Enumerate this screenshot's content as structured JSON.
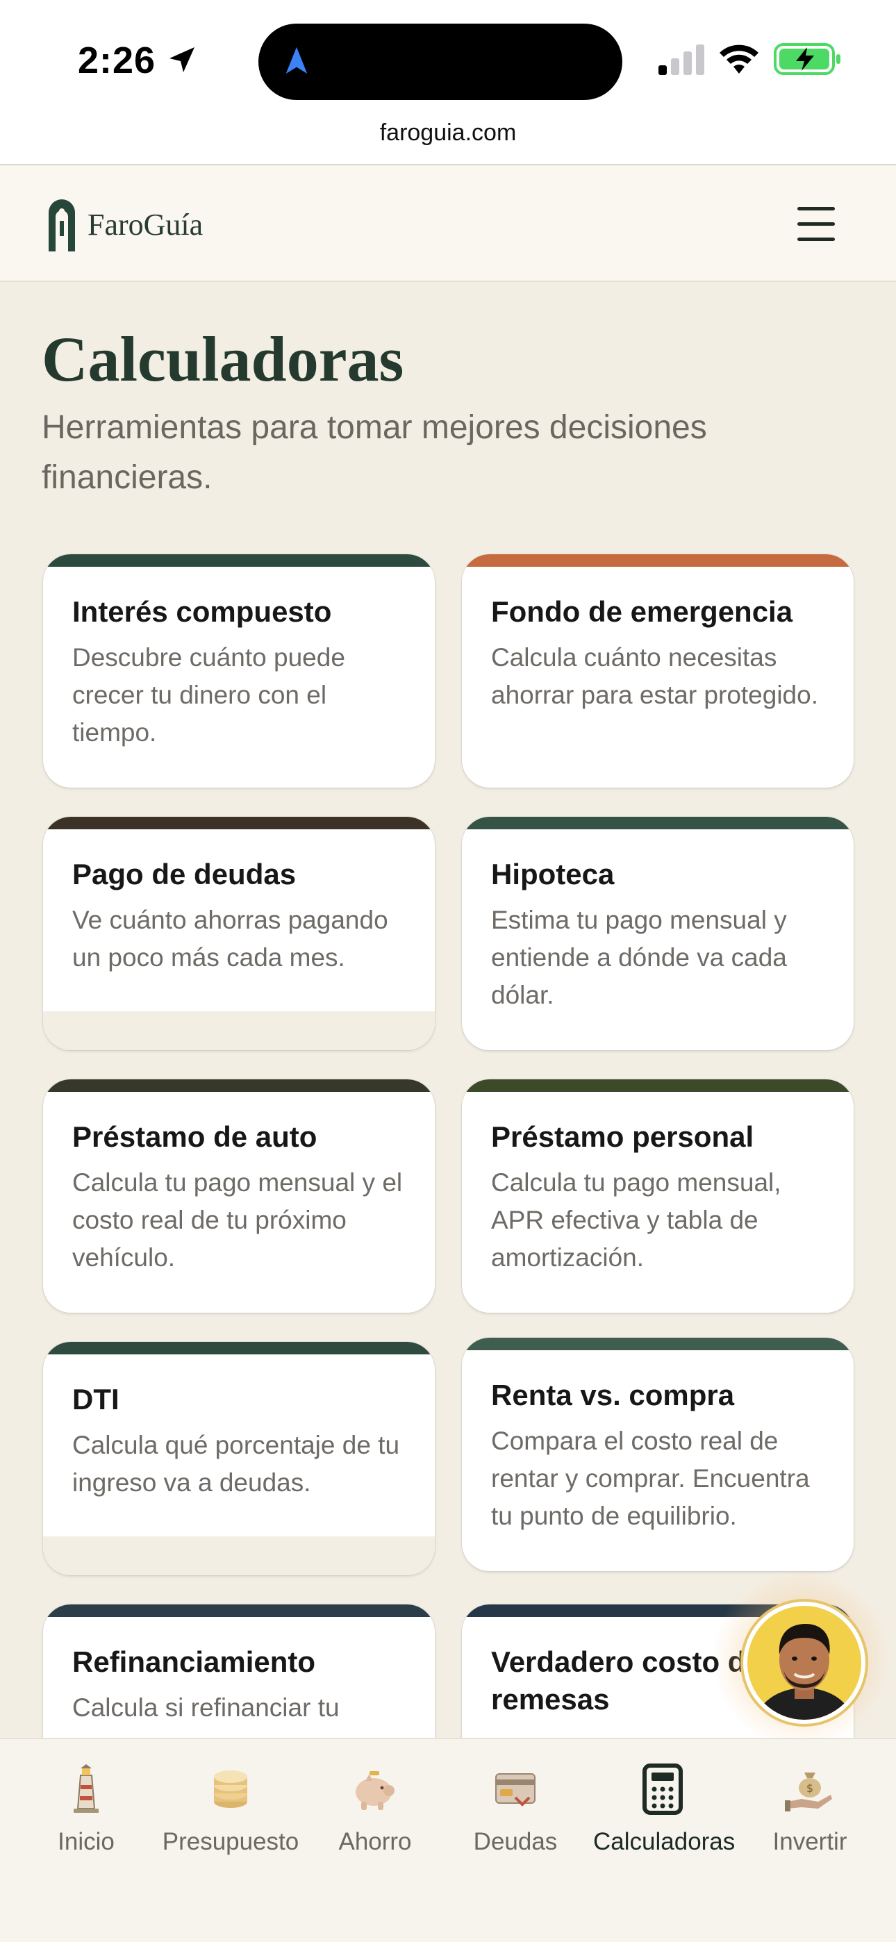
{
  "status_bar": {
    "time": "2:26"
  },
  "browser": {
    "url": "faroguia.com"
  },
  "header": {
    "logo_text": "FaroGuía"
  },
  "page": {
    "title": "Calculadoras",
    "subtitle": "Herramientas para tomar mejores decisiones financieras."
  },
  "cards": [
    {
      "title": "Interés compuesto",
      "description": "Descubre cuánto puede crecer tu dinero con el tiempo.",
      "accent": "#2d4a3e"
    },
    {
      "title": "Fondo de emergencia",
      "description": "Calcula cuánto necesitas ahorrar para estar protegido.",
      "accent": "#c66a3f"
    },
    {
      "title": "Pago de deudas",
      "description": "Ve cuánto ahorras pagando un poco más cada mes.",
      "accent": "#3d3226"
    },
    {
      "title": "Hipoteca",
      "description": "Estima tu pago mensual y entiende a dónde va cada dólar.",
      "accent": "#355446"
    },
    {
      "title": "Préstamo de auto",
      "description": "Calcula tu pago mensual y el costo real de tu próximo vehículo.",
      "accent": "#36382a"
    },
    {
      "title": "Préstamo personal",
      "description": "Calcula tu pago mensual, APR efectiva y tabla de amortización.",
      "accent": "#3c4a2a"
    },
    {
      "title": "DTI",
      "description": "Calcula qué porcentaje de tu ingreso va a deudas.",
      "accent": "#2f4a3e"
    },
    {
      "title": "Renta vs. compra",
      "description": "Compara el costo real de rentar y comprar. Encuentra tu punto de equilibrio.",
      "accent": "#3f5e50"
    },
    {
      "title": "Refinanciamiento",
      "description": "Calcula si refinanciar tu",
      "accent": "#2c3e4a"
    },
    {
      "title": "Verdadero costo de remesas",
      "description": "",
      "accent": "#263848"
    }
  ],
  "bottom_nav": [
    {
      "label": "Inicio",
      "icon": "lighthouse-icon"
    },
    {
      "label": "Presupuesto",
      "icon": "coins-icon"
    },
    {
      "label": "Ahorro",
      "icon": "piggy-bank-icon"
    },
    {
      "label": "Deudas",
      "icon": "credit-card-icon"
    },
    {
      "label": "Calculadoras",
      "icon": "calculator-icon",
      "active": true
    },
    {
      "label": "Invertir",
      "icon": "money-bag-hand-icon"
    }
  ],
  "colors": {
    "brand": "#243a2f",
    "background": "#f3eee4",
    "battery_green": "#4cd964"
  }
}
